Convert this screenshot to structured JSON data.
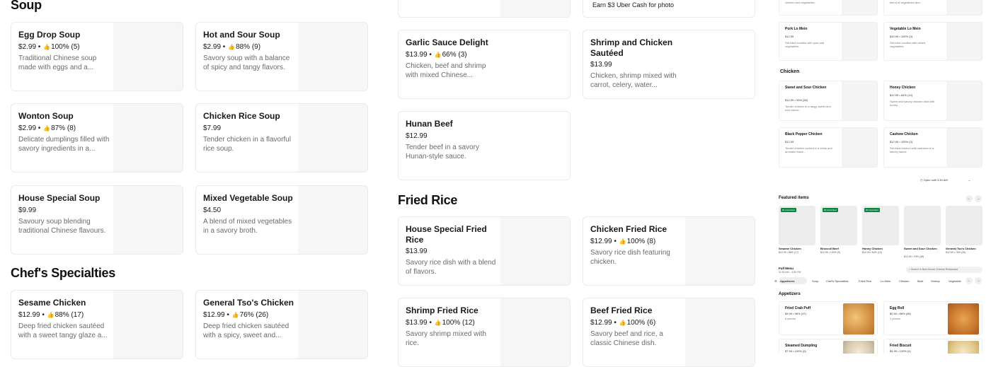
{
  "sections": {
    "soup": "Soup",
    "chefs": "Chef's Specialties",
    "fried_rice": "Fried Rice"
  },
  "promo": "Earn $3 Uber Cash for photo",
  "items": {
    "egg_drop": {
      "name": "Egg Drop Soup",
      "price": "$2.99",
      "rating": "100% (5)",
      "desc": "Traditional Chinese soup made with eggs and a..."
    },
    "hot_sour": {
      "name": "Hot and Sour Soup",
      "price": "$2.99",
      "rating": "88% (9)",
      "desc": "Savory soup with a balance of spicy and tangy flavors."
    },
    "wonton": {
      "name": "Wonton Soup",
      "price": "$2.99",
      "rating": "87% (8)",
      "desc": "Delicate dumplings filled with savory ingredients in a..."
    },
    "chicken_rice_soup": {
      "name": "Chicken Rice Soup",
      "price": "$7.99",
      "desc": "Tender chicken in a flavorful rice soup."
    },
    "house_special_soup": {
      "name": "House Special Soup",
      "price": "$9.99",
      "desc": "Savoury soup blending traditional Chinese flavours."
    },
    "mixed_veg_soup": {
      "name": "Mixed Vegetable Soup",
      "price": "$4.50",
      "desc": "A blend of mixed vegetables in a savory broth."
    },
    "sesame": {
      "name": "Sesame Chicken",
      "price": "$12.99",
      "rating": "88% (17)",
      "desc": "Deep fried chicken sautéed with a sweet tangy glaze a..."
    },
    "general_tso": {
      "name": "General Tso's Chicken",
      "price": "$12.99",
      "rating": "76% (26)",
      "desc": "Deep fried chicken sautéed with a spicy, sweet and..."
    },
    "garlic_sauce": {
      "name": "Garlic Sauce Delight",
      "price": "$13.99",
      "rating": "66% (3)",
      "desc": "Chicken, beef and shrimp with mixed Chinese..."
    },
    "shrimp_chicken": {
      "name": "Shrimp and Chicken Sautéed",
      "price": "$13.99",
      "desc": "Chicken, shrimp mixed with carrot, celery, water..."
    },
    "hunan_beef": {
      "name": "Hunan Beef",
      "price": "$12.99",
      "desc": "Tender beef in a savory Hunan-style sauce."
    },
    "house_fried_rice": {
      "name": "House Special Fried Rice",
      "price": "$13.99",
      "desc": "Savory rice dish with a blend of flavors."
    },
    "chicken_fried_rice": {
      "name": "Chicken Fried Rice",
      "price": "$12.99",
      "rating": "100% (8)",
      "desc": "Savory rice dish featuring chicken."
    },
    "shrimp_fried_rice": {
      "name": "Shrimp Fried Rice",
      "price": "$13.99",
      "rating": "100% (12)",
      "desc": "Savory shrimp mixed with rice."
    },
    "beef_fried_rice": {
      "name": "Beef Fried Rice",
      "price": "$12.99",
      "rating": "100% (6)",
      "desc": "Savory beef and rice, a classic Chinese dish."
    }
  },
  "mini": {
    "top_desc_1": "chicken and vegetables.",
    "top_desc_2": "blend of vegetables and...",
    "pork_lo_mein": {
      "name": "Pork Lo Mein",
      "meta": "$12.99",
      "desc": "Stir-fried noodles with pork and vegetables."
    },
    "veg_lo_mein": {
      "name": "Vegetable Lo Mein",
      "meta": "$10.99 • 100% (3)",
      "desc": "Stir-fried noodles with mixed vegetables."
    },
    "chicken_head": "Chicken",
    "sweet_sour": {
      "name": "Sweet and Sour Chicken",
      "meta": "$12.99 • 93% (38)",
      "desc": "Tender chicken in a tangy sweet and sour sauce."
    },
    "honey_chicken": {
      "name": "Honey Chicken",
      "meta": "$12.99 • 84% (13)",
      "desc": "Sweet and savory chicken dish with honey."
    },
    "black_pepper": {
      "name": "Black Pepper Chicken",
      "meta": "$12.99",
      "desc": "Tender chicken cooked in a zesty and aromatic black..."
    },
    "cashew": {
      "name": "Cashew Chicken",
      "meta": "$12.99 • 100% (3)",
      "desc": "Stir-fried chicken with cashews in a savory sauce."
    },
    "open_until": "Open until 3:30 AM",
    "featured_head": "Featured items",
    "featured": [
      {
        "badge": "#1 most liked",
        "name": "Sesame Chicken",
        "meta": "$12.99 • 88% (17)"
      },
      {
        "badge": "#3 most liked",
        "name": "Broccoli Beef",
        "meta": "$12.99 • 100% (9)"
      },
      {
        "badge": "#2 most liked",
        "name": "Honey Chicken",
        "meta": "$12.99 • 84% (13)"
      },
      {
        "badge": "",
        "name": "Sweet and Sour Chicken",
        "meta": "$12.99 • 93% (38)"
      },
      {
        "badge": "",
        "name": "General Tso's Chicken",
        "meta": "$12.99 • 76% (26)"
      }
    ],
    "full_menu": "Full Menu",
    "hours": "11:00 AM – 3:30 PM",
    "search_placeholder": "Search in New Hunan Chinese Restaurant",
    "tabs": [
      "Appetizers",
      "Soup",
      "Chef's Specialties",
      "Fried Rice",
      "Lo Mein",
      "Chicken",
      "Beef",
      "Shrimp",
      "Vegetable"
    ],
    "appetizers_head": "Appetizers",
    "crab_puff": {
      "name": "Fried Crab Puff",
      "meta": "$3.99 • 96% (37)",
      "desc": "8 pieces"
    },
    "egg_roll": {
      "name": "Egg Roll",
      "meta": "$2.50 • 88% (46)",
      "desc": "2 pieces"
    },
    "steamed_dumpling": {
      "name": "Steamed Dumpling",
      "meta": "$7.99 • 100% (5)"
    },
    "fried_biscuit": {
      "name": "Fried Biscuit",
      "meta": "$4.99 • 100% (4)"
    }
  }
}
